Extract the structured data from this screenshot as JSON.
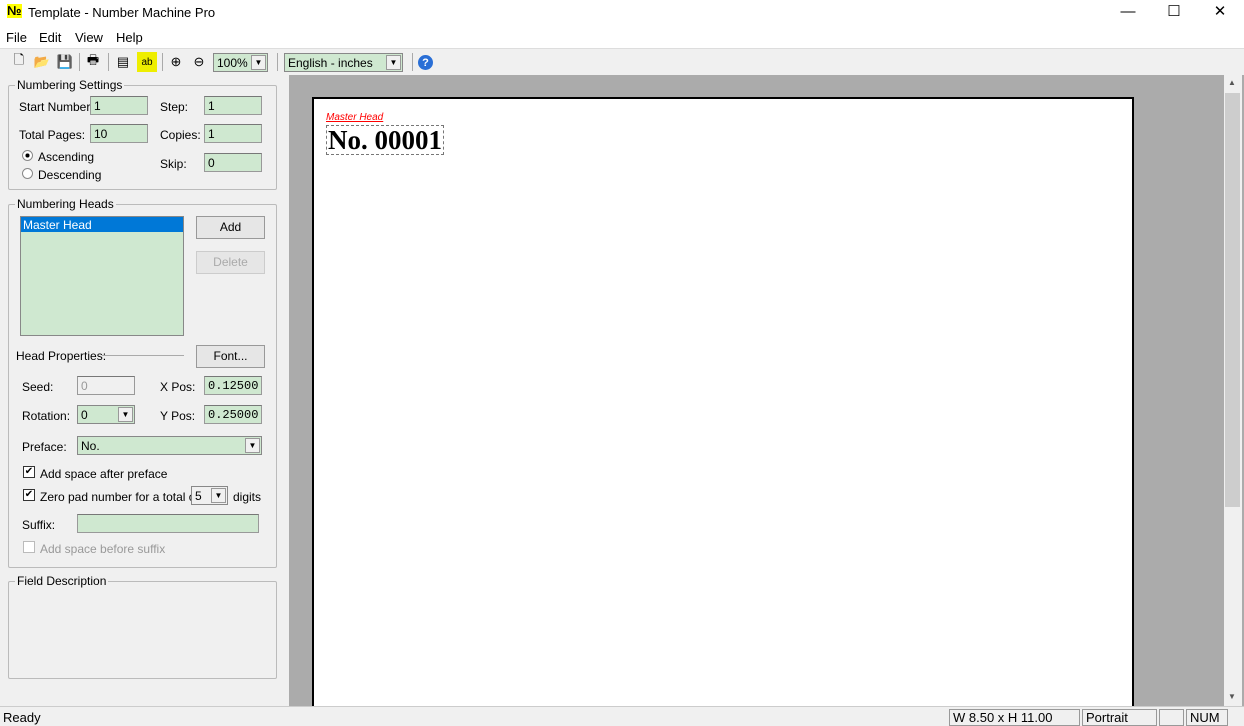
{
  "window": {
    "title": "Template - Number Machine Pro",
    "minimize": "—",
    "maximize": "☐",
    "close": "✕"
  },
  "menu": [
    "File",
    "Edit",
    "View",
    "Help"
  ],
  "toolbar": {
    "icons": [
      "new-icon",
      "open-icon",
      "save-icon",
      "print-icon",
      "properties-icon",
      "spelling-icon",
      "zoom-in-icon",
      "zoom-out-icon",
      "help-icon"
    ],
    "zoom": "100%",
    "units": "English - inches"
  },
  "numbering_settings": {
    "title": "Numbering Settings",
    "start_label": "Start Number:",
    "start": "1",
    "step_label": "Step:",
    "step": "1",
    "total_label": "Total Pages:",
    "total": "10",
    "copies_label": "Copies:",
    "copies": "1",
    "skip_label": "Skip:",
    "skip": "0",
    "ascending": "Ascending",
    "descending": "Descending",
    "order": "ascending"
  },
  "numbering_heads": {
    "title": "Numbering Heads",
    "items": [
      "Master Head"
    ],
    "add": "Add",
    "delete": "Delete",
    "head_props": "Head Properties:",
    "font": "Font...",
    "seed_label": "Seed:",
    "seed": "0",
    "xpos_label": "X Pos:",
    "xpos": "0.12500",
    "rotation_label": "Rotation:",
    "rotation": "0",
    "ypos_label": "Y Pos:",
    "ypos": "0.25000",
    "preface_label": "Preface:",
    "preface": "No.",
    "add_space_after": "Add space after preface",
    "zero_pad": "Zero pad number for a total of",
    "digits": "5",
    "digits_label": "digits",
    "suffix_label": "Suffix:",
    "suffix": "",
    "add_space_before": "Add space before suffix"
  },
  "field_description": {
    "title": "Field Description"
  },
  "preview": {
    "head_label": "Master Head",
    "number": "No. 00001",
    "label_color": "#ff0000"
  },
  "status": {
    "text": "Ready",
    "size": "W 8.50 x H 11.00",
    "orientation": "Portrait",
    "num": "NUM"
  }
}
